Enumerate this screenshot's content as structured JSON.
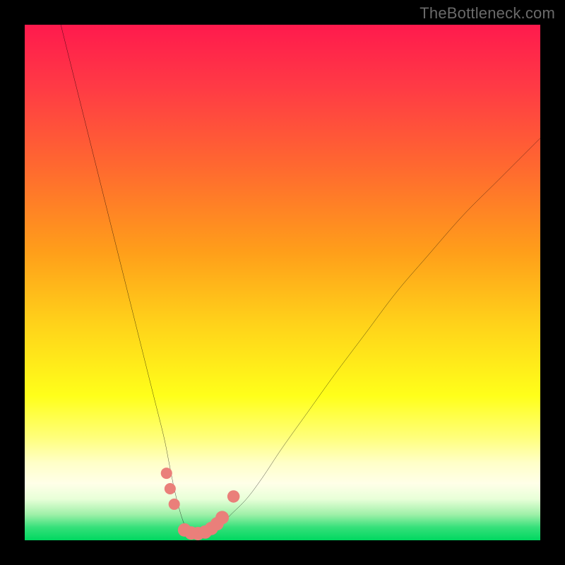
{
  "watermark": "TheBottleneck.com",
  "colors": {
    "frame": "#000000",
    "curve": "#000000",
    "marker": "#ea7f7a",
    "gradient_stops": [
      {
        "offset": 0.0,
        "color": "#ff1a4d"
      },
      {
        "offset": 0.12,
        "color": "#ff3a45"
      },
      {
        "offset": 0.28,
        "color": "#ff6a2f"
      },
      {
        "offset": 0.44,
        "color": "#ff9e1a"
      },
      {
        "offset": 0.58,
        "color": "#ffd21a"
      },
      {
        "offset": 0.72,
        "color": "#ffff1a"
      },
      {
        "offset": 0.8,
        "color": "#ffff7a"
      },
      {
        "offset": 0.85,
        "color": "#ffffc8"
      },
      {
        "offset": 0.89,
        "color": "#ffffe8"
      },
      {
        "offset": 0.92,
        "color": "#e8ffd8"
      },
      {
        "offset": 0.95,
        "color": "#9ff0a8"
      },
      {
        "offset": 0.975,
        "color": "#35e07a"
      },
      {
        "offset": 1.0,
        "color": "#00d860"
      }
    ]
  },
  "chart_data": {
    "type": "line",
    "title": "",
    "xlabel": "",
    "ylabel": "",
    "xlim": [
      0,
      100
    ],
    "ylim": [
      0,
      100
    ],
    "grid": false,
    "series": [
      {
        "name": "bottleneck-curve",
        "x": [
          7,
          9,
          11,
          13,
          15,
          17,
          19,
          21,
          23,
          25,
          27,
          28,
          29,
          30,
          31,
          32,
          33,
          34,
          35,
          36,
          38,
          40,
          43,
          46,
          50,
          55,
          60,
          66,
          72,
          78,
          85,
          92,
          100
        ],
        "values": [
          100,
          92,
          84,
          76,
          68,
          60,
          52,
          44,
          36,
          28,
          20,
          15,
          10,
          6,
          3,
          1.5,
          1,
          1,
          1.5,
          2,
          3,
          5,
          8,
          12,
          18,
          25,
          32,
          40,
          48,
          55,
          63,
          70,
          78
        ]
      }
    ],
    "markers": [
      {
        "x": 27.5,
        "y": 13,
        "r": 1.1
      },
      {
        "x": 28.2,
        "y": 10,
        "r": 1.1
      },
      {
        "x": 29.0,
        "y": 7,
        "r": 1.1
      },
      {
        "x": 31.0,
        "y": 2.0,
        "r": 1.3
      },
      {
        "x": 32.3,
        "y": 1.4,
        "r": 1.3
      },
      {
        "x": 33.6,
        "y": 1.3,
        "r": 1.3
      },
      {
        "x": 35.0,
        "y": 1.6,
        "r": 1.3
      },
      {
        "x": 36.2,
        "y": 2.3,
        "r": 1.3
      },
      {
        "x": 37.3,
        "y": 3.2,
        "r": 1.3
      },
      {
        "x": 38.3,
        "y": 4.4,
        "r": 1.3
      },
      {
        "x": 40.5,
        "y": 8.5,
        "r": 1.2
      }
    ]
  }
}
